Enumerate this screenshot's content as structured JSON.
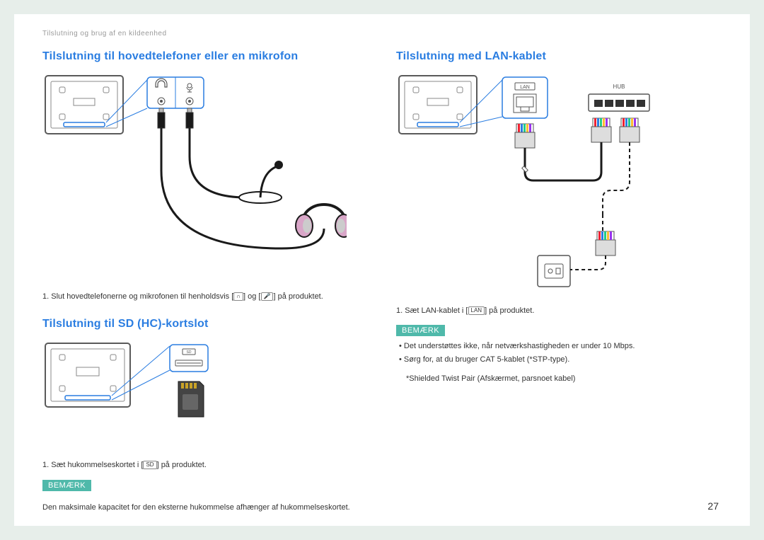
{
  "header": "Tilslutning og brug af en kildeenhed",
  "page_number": "27",
  "left": {
    "section1": {
      "title": "Tilslutning til hovedtelefoner eller en mikrofon",
      "step": "1. Slut hovedtelefonerne og mikrofonen til henholdsvis [",
      "step_mid": "] og [",
      "step_end": "] på produktet."
    },
    "section2": {
      "title": "Tilslutning til SD (HC)-kortslot",
      "step": "1. Sæt hukommelseskortet i [",
      "step_end": "] på produktet.",
      "note_label": "BEMÆRK",
      "note": "Den maksimale kapacitet for den eksterne hukommelse afhænger af hukommelseskortet."
    }
  },
  "right": {
    "title": "Tilslutning med LAN-kablet",
    "lan_label": "LAN",
    "hub_label": "HUB",
    "step": "1. Sæt LAN-kablet i [",
    "step_end": "] på produktet.",
    "note_label": "BEMÆRK",
    "bullet1": "Det understøttes ikke, når netværkshastigheden er under 10 Mbps.",
    "bullet2a": "Sørg for, at du bruger CAT 5-kablet (*STP-type).",
    "bullet2b": "*Shielded Twist Pair (Afskærmet, parsnoet kabel)",
    "lan_inline": "LAN"
  }
}
